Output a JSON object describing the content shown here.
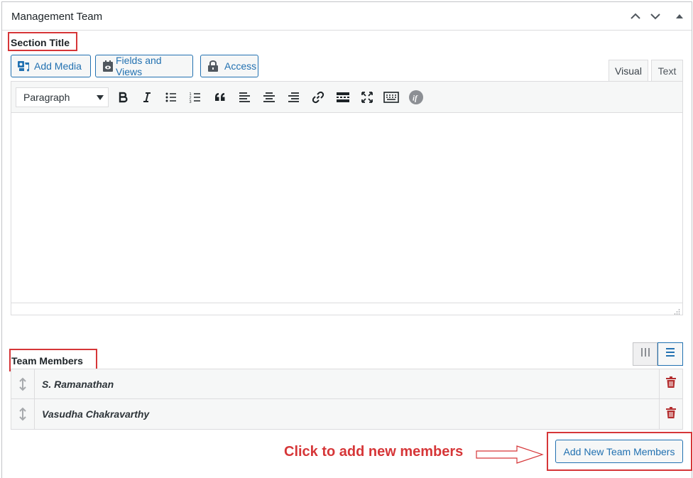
{
  "panel": {
    "title": "Management Team"
  },
  "section_title": {
    "label": "Section Title"
  },
  "media_buttons": {
    "add_media": "Add Media",
    "fields_and_views": "Fields and Views",
    "access": "Access"
  },
  "editor": {
    "tab_visual": "Visual",
    "tab_text": "Text",
    "format_select": "Paragraph",
    "toolbar_icons": [
      "bold-icon",
      "italic-icon",
      "bullet-list-icon",
      "numbered-list-icon",
      "blockquote-icon",
      "align-left-icon",
      "align-center-icon",
      "align-right-icon",
      "link-icon",
      "read-more-icon",
      "fullscreen-icon",
      "toolbar-toggle-icon",
      "conditional-if-icon"
    ]
  },
  "team_members": {
    "label": "Team Members",
    "rows": [
      {
        "name": "S. Ramanathan"
      },
      {
        "name": "Vasudha Chakravarthy"
      }
    ],
    "add_button": "Add New Team Members"
  },
  "annotation": {
    "hint": "Click to add new members"
  },
  "colors": {
    "accent": "#2271b1",
    "highlight": "#d63638",
    "delete": "#b32d2e"
  }
}
